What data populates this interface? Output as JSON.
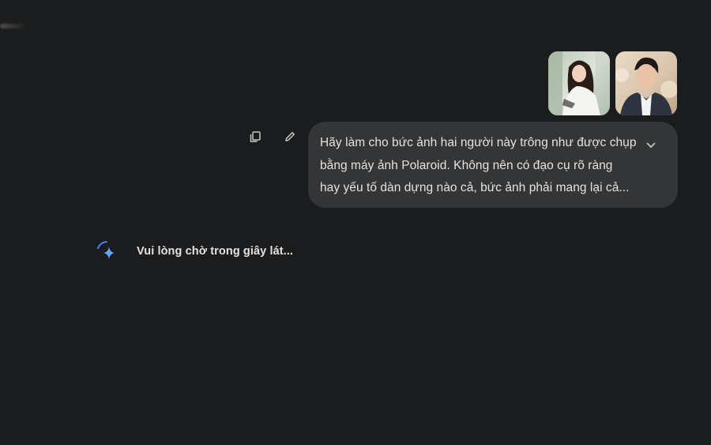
{
  "conversation": {
    "attachments": [
      {
        "name": "photo-woman",
        "icon": "woman-portrait-photo"
      },
      {
        "name": "photo-man",
        "icon": "man-portrait-photo"
      }
    ],
    "actions": {
      "copy": {
        "icon": "copy-icon"
      },
      "edit": {
        "icon": "pencil-icon"
      }
    },
    "prompt": {
      "lines": [
        "Hãy làm cho bức ảnh hai người này trông như được chụp",
        "bằng máy ảnh Polaroid. Không nên có đạo cụ rõ ràng",
        "hay yếu tố dàn dựng nào cả, bức ảnh phải mang lại cả..."
      ],
      "expand_icon": "chevron-down-icon"
    },
    "status": {
      "icon": "gemini-spark-loading-icon",
      "text": "Vui lòng chờ trong giây lát..."
    }
  },
  "colors": {
    "background": "#1b1c1d",
    "bubble": "#333537",
    "text": "#e3e3e3",
    "icon": "#c4c7c5",
    "accent_blue": "#4285f4"
  }
}
